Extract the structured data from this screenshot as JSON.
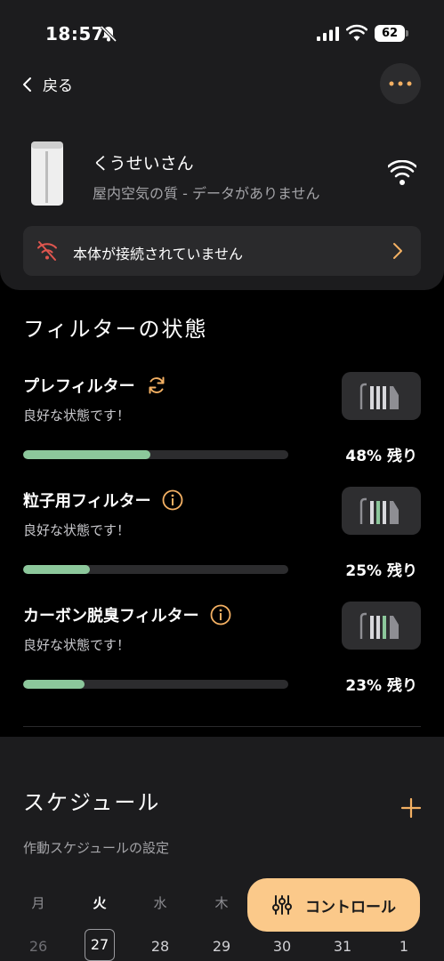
{
  "status_bar": {
    "time": "18:57",
    "battery": "62"
  },
  "header": {
    "back_label": "戻る"
  },
  "device": {
    "name": "くうせいさん",
    "subtitle": "屋内空気の質 - データがありません",
    "connection_warning": "本体が接続されていません"
  },
  "filters": {
    "title": "フィルターの状態",
    "items": [
      {
        "name": "プレフィルター",
        "status": "良好な状態です！",
        "remaining_pct": 48,
        "remaining_label": "48% 残り",
        "icon": "refresh-icon"
      },
      {
        "name": "粒子用フィルター",
        "status": "良好な状態です！",
        "remaining_pct": 25,
        "remaining_label": "25% 残り",
        "icon": "info-icon"
      },
      {
        "name": "カーボン脱臭フィルター",
        "status": "良好な状態です！",
        "remaining_pct": 23,
        "remaining_label": "23% 残り",
        "icon": "info-icon"
      }
    ]
  },
  "schedule": {
    "title": "スケジュール",
    "subtitle": "作動スケジュールの設定",
    "weekdays": [
      "月",
      "火",
      "水",
      "木"
    ],
    "dates": [
      "26",
      "27",
      "28",
      "29",
      "30",
      "31",
      "1"
    ],
    "selected_date": "27"
  },
  "control_button": {
    "label": "コントロール"
  },
  "colors": {
    "accent": "#f3b063",
    "progress": "#8cc79b",
    "control_bg": "#fbc98a"
  }
}
